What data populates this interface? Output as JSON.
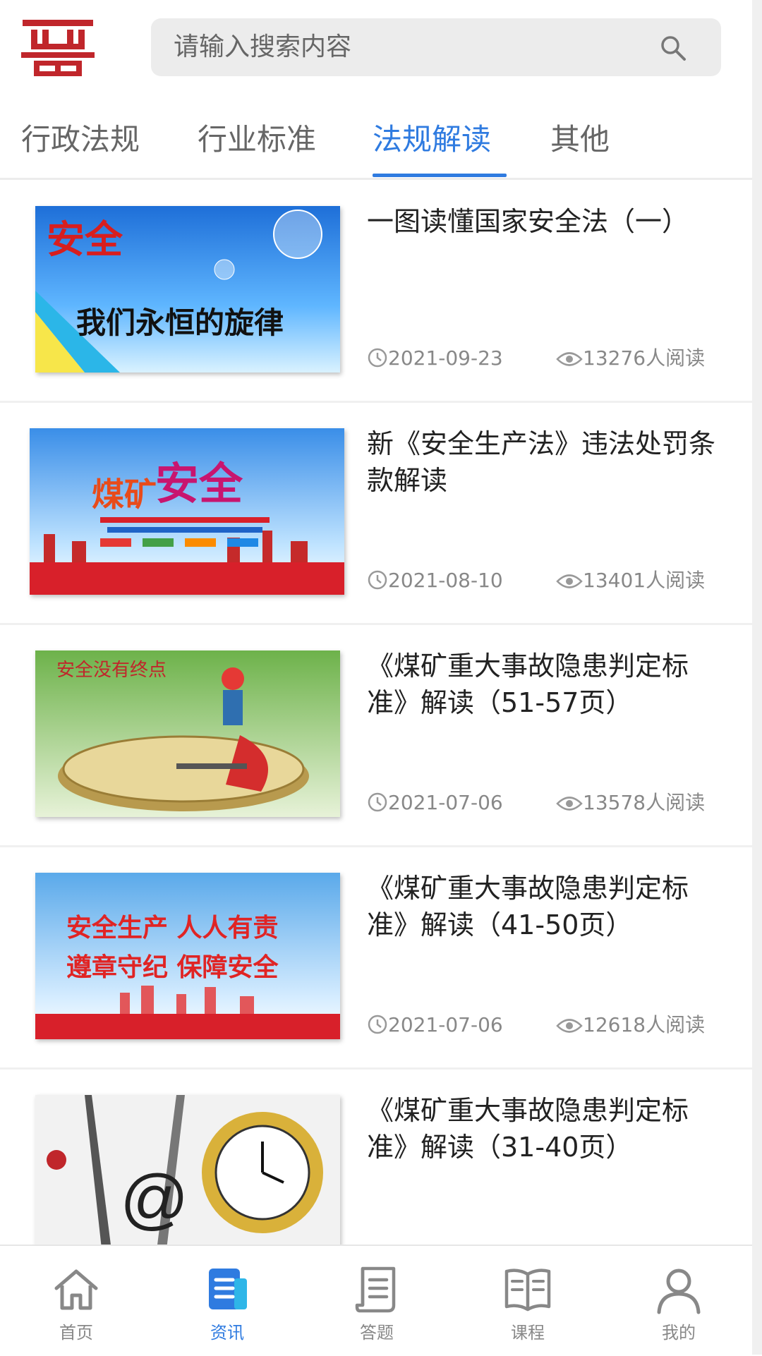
{
  "search": {
    "placeholder": "请输入搜索内容",
    "icon": "search-icon"
  },
  "tabs": [
    {
      "label": "行政法规",
      "active": false
    },
    {
      "label": "行业标准",
      "active": false
    },
    {
      "label": "法规解读",
      "active": true
    },
    {
      "label": "其他",
      "active": false
    }
  ],
  "articles": [
    {
      "title": "一图读懂国家安全法（一）",
      "date": "2021-09-23",
      "views": "13276人阅读",
      "thumb_text": [
        "安全",
        "我们永恒的旋律"
      ]
    },
    {
      "title": "新《安全生产法》违法处罚条款解读",
      "date": "2021-08-10",
      "views": "13401人阅读",
      "thumb_text": [
        "煤矿",
        "安全"
      ]
    },
    {
      "title": "《煤矿重大事故隐患判定标准》解读（51-57页）",
      "date": "2021-07-06",
      "views": "13578人阅读",
      "thumb_text": [
        "安全没有终点"
      ]
    },
    {
      "title": "《煤矿重大事故隐患判定标准》解读（41-50页）",
      "date": "2021-07-06",
      "views": "12618人阅读",
      "thumb_text": [
        "安全生产 人人有责",
        "遵章守纪 保障安全"
      ]
    },
    {
      "title": "《煤矿重大事故隐患判定标准》解读（31-40页）",
      "date": "",
      "views": "",
      "thumb_text": []
    }
  ],
  "bottom_nav": [
    {
      "label": "首页",
      "icon": "home-icon",
      "active": false
    },
    {
      "label": "资讯",
      "icon": "news-icon",
      "active": true
    },
    {
      "label": "答题",
      "icon": "quiz-icon",
      "active": false
    },
    {
      "label": "课程",
      "icon": "book-icon",
      "active": false
    },
    {
      "label": "我的",
      "icon": "user-icon",
      "active": false
    }
  ],
  "colors": {
    "accent": "#2f7be0",
    "logo": "#c0262b"
  }
}
